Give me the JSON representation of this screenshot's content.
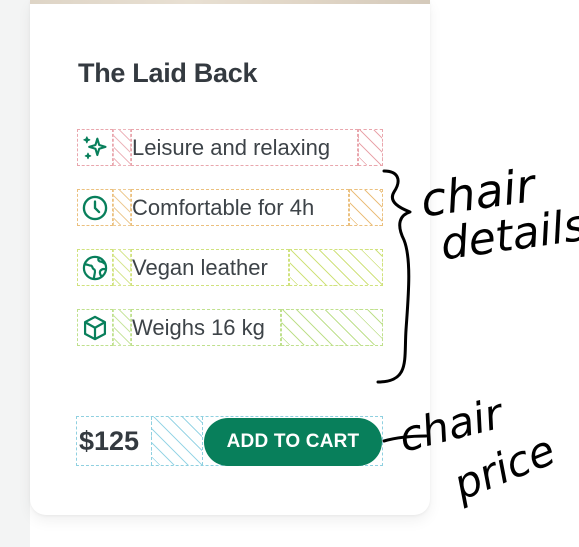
{
  "card": {
    "title": "The Laid Back",
    "details": [
      {
        "icon": "sparkles-icon",
        "label": "Leisure and relaxing"
      },
      {
        "icon": "clock-icon",
        "label": "Comfortable for 4h"
      },
      {
        "icon": "globe-icon",
        "label": "Vegan leather"
      },
      {
        "icon": "box-icon",
        "label": "Weighs 16 kg"
      }
    ],
    "price": "$125",
    "cart_button_label": "ADD TO CART",
    "accent_color": "#087f5b"
  },
  "annotations": {
    "details_note_line1": "chair",
    "details_note_line2": "details",
    "price_note_line1": "chair",
    "price_note_line2": "price"
  }
}
